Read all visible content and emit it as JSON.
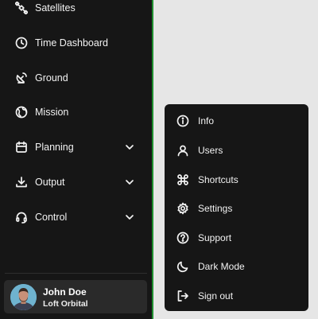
{
  "sidebar": {
    "items": [
      {
        "label": "Satellites",
        "icon": "satellite-icon"
      },
      {
        "label": "Time Dashboard",
        "icon": "clock-icon"
      },
      {
        "label": "Ground",
        "icon": "satellite-dish-icon"
      },
      {
        "label": "Mission",
        "icon": "globe-icon"
      },
      {
        "label": "Planning",
        "icon": "calendar-icon",
        "expandable": true
      },
      {
        "label": "Output",
        "icon": "download-icon",
        "expandable": true
      },
      {
        "label": "Control",
        "icon": "headset-icon",
        "expandable": true
      }
    ],
    "active_edge_color": "#1f8f2f"
  },
  "user": {
    "name": "John Doe",
    "org": "Loft Orbital"
  },
  "user_menu": {
    "items": [
      {
        "label": "Info",
        "icon": "info-icon"
      },
      {
        "label": "Users",
        "icon": "user-icon"
      },
      {
        "label": "Shortcuts",
        "icon": "command-icon"
      },
      {
        "label": "Settings",
        "icon": "gear-icon"
      },
      {
        "label": "Support",
        "icon": "help-circle-icon"
      },
      {
        "label": "Dark Mode",
        "icon": "moon-icon"
      },
      {
        "label": "Sign out",
        "icon": "sign-out-icon"
      }
    ]
  }
}
